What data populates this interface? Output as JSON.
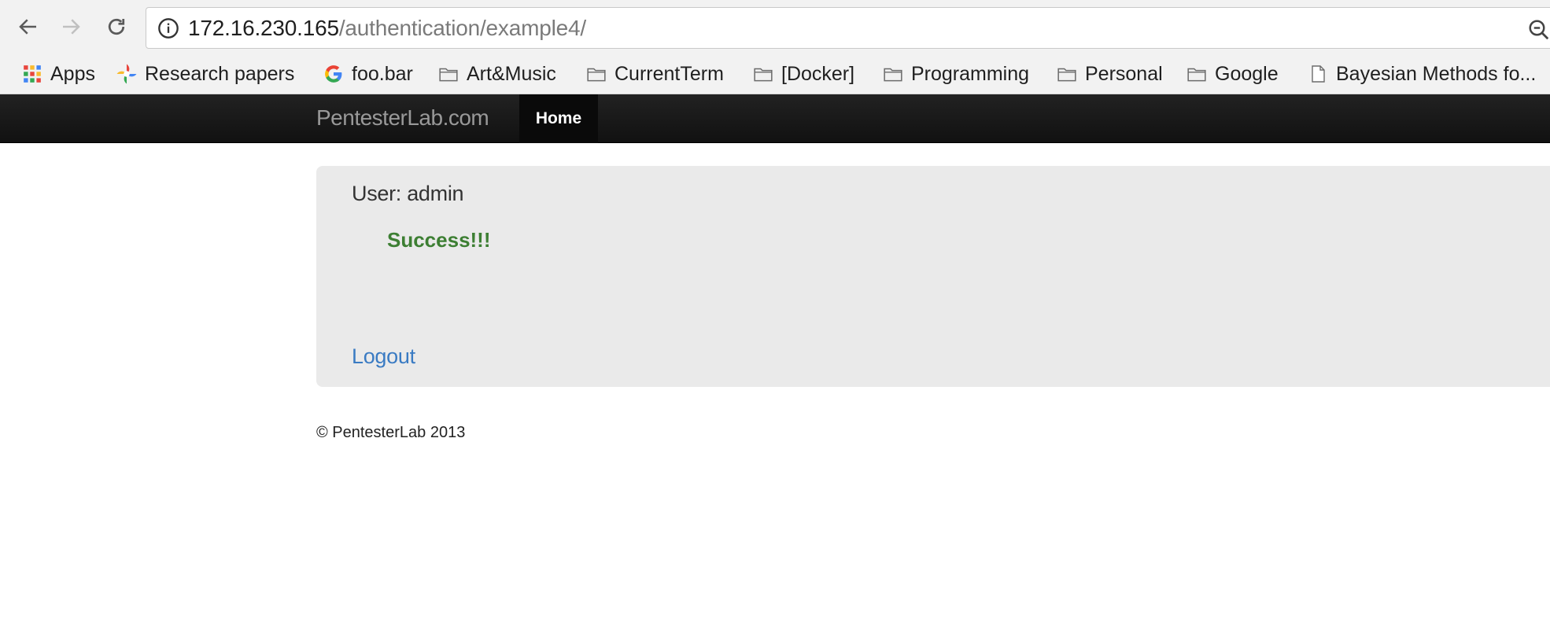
{
  "browser": {
    "url_host": "172.16.230.165",
    "url_path": "/authentication/example4/",
    "icons": {
      "back": "back-arrow-icon",
      "forward": "forward-arrow-icon",
      "reload": "reload-icon",
      "info": "info-icon",
      "zoom": "zoom-icon"
    }
  },
  "bookmarks": [
    {
      "label": "Apps",
      "icon": "apps-grid-icon"
    },
    {
      "label": "Research papers",
      "icon": "photos-pinwheel-icon"
    },
    {
      "label": "foo.bar",
      "icon": "google-g-icon"
    },
    {
      "label": "Art&Music",
      "icon": "folder-icon"
    },
    {
      "label": "CurrentTerm",
      "icon": "folder-icon"
    },
    {
      "label": "[Docker]",
      "icon": "folder-icon"
    },
    {
      "label": "Programming",
      "icon": "folder-icon"
    },
    {
      "label": "Personal",
      "icon": "folder-icon"
    },
    {
      "label": "Google",
      "icon": "folder-icon"
    },
    {
      "label": "Bayesian Methods fo...",
      "icon": "page-icon"
    }
  ],
  "site": {
    "brand": "PentesterLab.com",
    "nav_home": "Home",
    "user_label": "User: admin",
    "success_message": "Success!!!",
    "logout_label": "Logout",
    "footer": "© PentesterLab 2013"
  },
  "colors": {
    "success": "#3d7f33",
    "link": "#3a7bc3",
    "navbar": "#1a1a1a",
    "panel": "#eaeaea"
  }
}
